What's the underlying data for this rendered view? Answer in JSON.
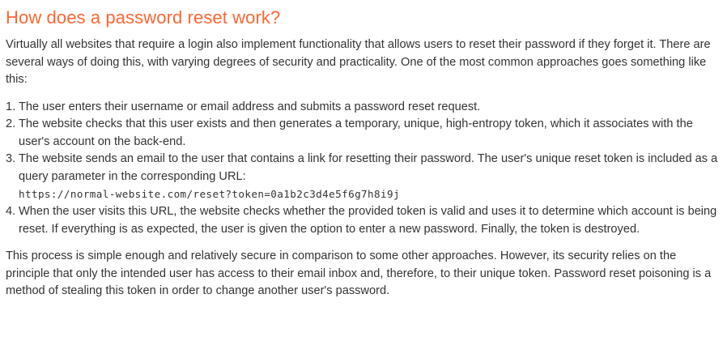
{
  "article": {
    "heading": "How does a password reset work?",
    "intro": "Virtually all websites that require a login also implement functionality that allows users to reset their password if they forget it. There are several ways of doing this, with varying degrees of security and practicality. One of the most common approaches goes something like this:",
    "steps": [
      {
        "number": "1.",
        "text": "The user enters their username or email address and submits a password reset request."
      },
      {
        "number": "2.",
        "text": "The website checks that this user exists and then generates a temporary, unique, high-entropy token, which it associates with the user's account on the back-end."
      },
      {
        "number": "3.",
        "text": "The website sends an email to the user that contains a link for resetting their password. The user's unique reset token is included as a query parameter in the corresponding URL:",
        "code": "https://normal-website.com/reset?token=0a1b2c3d4e5f6g7h8i9j"
      },
      {
        "number": "4.",
        "text": "When the user visits this URL, the website checks whether the provided token is valid and uses it to determine which account is being reset. If everything is as expected, the user is given the option to enter a new password. Finally, the token is destroyed."
      }
    ],
    "conclusion": "This process is simple enough and relatively secure in comparison to some other approaches. However, its security relies on the principle that only the intended user has access to their email inbox and, therefore, to their unique token. Password reset poisoning is a method of stealing this token in order to change another user's password."
  },
  "colors": {
    "heading": "#ff6633",
    "body_text": "#333332",
    "background": "#ffffff"
  }
}
